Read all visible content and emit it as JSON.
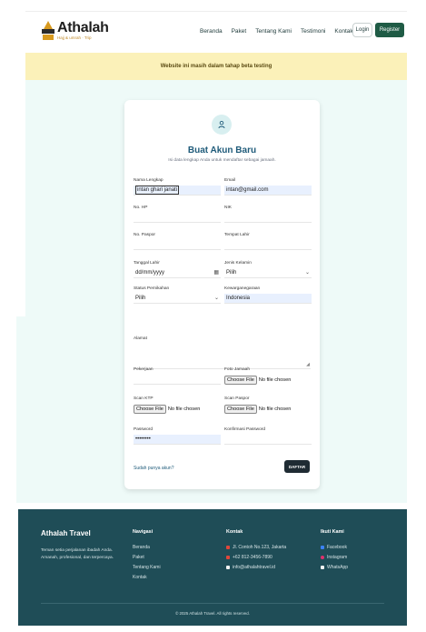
{
  "header": {
    "brand": "Athalah",
    "tagline": "Hajj & umrah · Trip",
    "nav": [
      "Beranda",
      "Paket",
      "Tentang Kami",
      "Testimoni",
      "Kontak"
    ],
    "login": "Login",
    "register": "Register"
  },
  "banner": {
    "text": "Website ini masih dalam tahap beta testing"
  },
  "form": {
    "title": "Buat Akun Baru",
    "subtitle": "Isi data lengkap Anda untuk mendaftar sebagai jamaah.",
    "fields": {
      "nama": {
        "label": "Nama Lengkap",
        "value": "intan ghari janati"
      },
      "email": {
        "label": "Email",
        "value": "intan@gmail.com"
      },
      "hp": {
        "label": "No. HP",
        "value": ""
      },
      "nik": {
        "label": "NIK",
        "value": ""
      },
      "paspor": {
        "label": "No. Paspor",
        "value": ""
      },
      "tempat_lahir": {
        "label": "Tempat Lahir",
        "value": ""
      },
      "tanggal_lahir": {
        "label": "Tanggal Lahir",
        "value": "dd/mm/yyyy"
      },
      "jenis_kelamin": {
        "label": "Jenis Kelamin",
        "value": "Pilih"
      },
      "status": {
        "label": "Status Pernikahan",
        "value": "Pilih"
      },
      "kewarganegaraan": {
        "label": "Kewarganegaraan",
        "value": "Indonesia"
      },
      "alamat": {
        "label": "Alamat",
        "value": ""
      },
      "pekerjaan": {
        "label": "Pekerjaan",
        "value": ""
      },
      "foto": {
        "label": "Foto Jamaah",
        "button": "Choose File",
        "status": "No file chosen"
      },
      "scan_ktp": {
        "label": "Scan KTP",
        "button": "Choose File",
        "status": "No file chosen"
      },
      "scan_paspor": {
        "label": "Scan Paspor",
        "button": "Choose File",
        "status": "No file chosen"
      },
      "password": {
        "label": "Password",
        "value": "••••••••"
      },
      "konfirmasi": {
        "label": "Konfirmasi Password",
        "value": ""
      }
    },
    "login_link": "Sudah punya akun?",
    "submit": "DAFTAR"
  },
  "footer": {
    "brand": "Athalah Travel",
    "description": "Teman setia perjalanan ibadah Anda. Amanah, profesional, dan terpercaya.",
    "navigasi": {
      "title": "Navigasi",
      "items": [
        "Beranda",
        "Paket",
        "Tentang Kami",
        "Kontak"
      ]
    },
    "kontak": {
      "title": "Kontak",
      "items": [
        "Jl. Contoh No.123, Jakarta",
        "+62 812-3456-7890",
        "info@athalahtravel.id"
      ]
    },
    "ikuti": {
      "title": "Ikuti Kami",
      "items": [
        "Facebook",
        "Instagram",
        "WhatsApp"
      ]
    },
    "copyright": "© 2025 Athalah Travel. All rights reserved."
  },
  "colors": {
    "primary": "#1f5b45",
    "footer": "#1f4d57",
    "banner": "#fbf1b9",
    "title": "#1f5b7a"
  }
}
